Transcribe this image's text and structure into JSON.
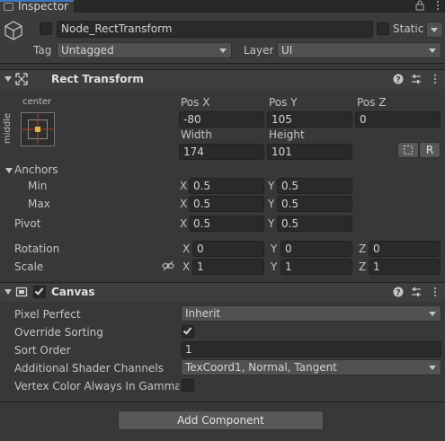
{
  "tab": {
    "title": "Inspector"
  },
  "object": {
    "name": "Node_RectTransform",
    "static_label": "Static",
    "tag_label": "Tag",
    "tag_value": "Untagged",
    "layer_label": "Layer",
    "layer_value": "UI"
  },
  "rect_transform": {
    "title": "Rect Transform",
    "anchor_preset": {
      "horizontal": "center",
      "vertical": "middle"
    },
    "labels": {
      "pos_x": "Pos X",
      "pos_y": "Pos Y",
      "pos_z": "Pos Z",
      "width": "Width",
      "height": "Height"
    },
    "values": {
      "pos_x": "-80",
      "pos_y": "105",
      "pos_z": "0",
      "width": "174",
      "height": "101"
    },
    "raw_button": "R",
    "anchors_label": "Anchors",
    "min_label": "Min",
    "max_label": "Max",
    "pivot_label": "Pivot",
    "rotation_label": "Rotation",
    "scale_label": "Scale",
    "axis": {
      "x": "X",
      "y": "Y",
      "z": "Z"
    },
    "anchor_min": {
      "x": "0.5",
      "y": "0.5"
    },
    "anchor_max": {
      "x": "0.5",
      "y": "0.5"
    },
    "pivot": {
      "x": "0.5",
      "y": "0.5"
    },
    "rotation": {
      "x": "0",
      "y": "0",
      "z": "0"
    },
    "scale": {
      "x": "1",
      "y": "1",
      "z": "1"
    }
  },
  "canvas": {
    "title": "Canvas",
    "pixel_perfect_label": "Pixel Perfect",
    "pixel_perfect_value": "Inherit",
    "override_sorting_label": "Override Sorting",
    "override_sorting_checked": true,
    "sort_order_label": "Sort Order",
    "sort_order_value": "1",
    "shader_channels_label": "Additional Shader Channels",
    "shader_channels_value": "TexCoord1, Normal, Tangent",
    "vertex_color_label": "Vertex Color Always In Gamma C",
    "vertex_color_checked": false
  },
  "add_component": "Add Component"
}
